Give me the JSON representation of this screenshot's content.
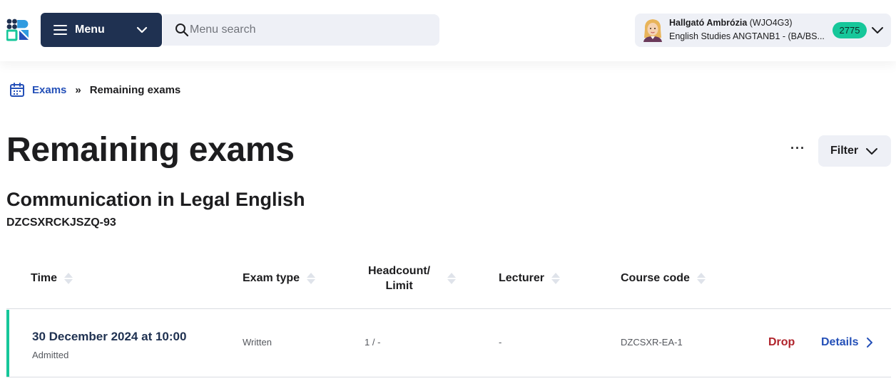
{
  "header": {
    "menu_label": "Menu",
    "search_placeholder": "Menu search",
    "user": {
      "name": "Hallgató Ambrózia",
      "code": "(WJO4G3)",
      "program": "English Studies ANGTANB1 - (BA/BS...",
      "badge": "2775"
    }
  },
  "breadcrumb": {
    "parent": "Exams",
    "separator": "»",
    "current": "Remaining exams"
  },
  "page": {
    "title": "Remaining exams",
    "more_label": "···",
    "filter_label": "Filter"
  },
  "course": {
    "name": "Communication in Legal English",
    "code": "DZCSXRCKJSZQ-93"
  },
  "table": {
    "columns": {
      "time": "Time",
      "exam_type": "Exam type",
      "headcount_line1": "Headcount/",
      "headcount_line2": "Limit",
      "lecturer": "Lecturer",
      "course_code": "Course code"
    },
    "rows": [
      {
        "date": "30 December 2024 at 10:00",
        "status": "Admitted",
        "exam_type": "Written",
        "headcount": "1 / -",
        "lecturer": "-",
        "course_code": "DZCSXR-EA-1",
        "drop_label": "Drop",
        "details_label": "Details"
      }
    ]
  },
  "colors": {
    "navy": "#1f3151",
    "accent_green": "#16c79a",
    "link_blue": "#2450b8",
    "drop_red": "#b0242c",
    "panel_gray": "#eef0f6"
  }
}
